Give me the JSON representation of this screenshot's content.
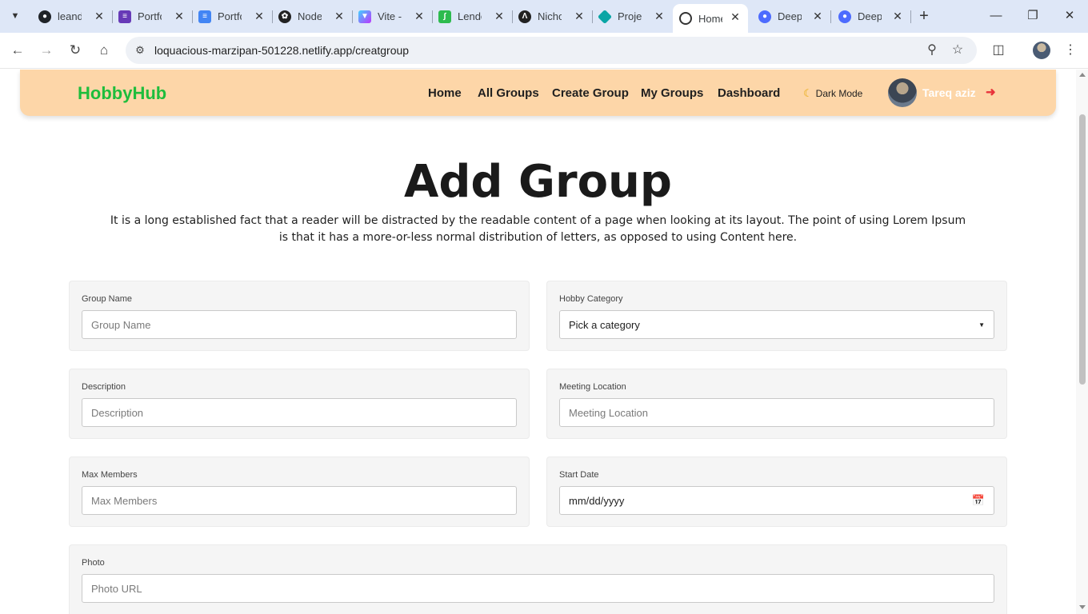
{
  "browser": {
    "tabs": [
      {
        "title": "leand",
        "favicon": "github-icon",
        "color": "#1f2328"
      },
      {
        "title": "Portfo",
        "favicon": "list-doc-icon",
        "color": "#673ab7"
      },
      {
        "title": "Portfo",
        "favicon": "docs-icon",
        "color": "#4285f4"
      },
      {
        "title": "Node",
        "favicon": "openai-icon",
        "color": "#222222"
      },
      {
        "title": "Vite -",
        "favicon": "vite-icon",
        "color": "#a855f7"
      },
      {
        "title": "Lende",
        "favicon": "lendsqr-icon",
        "color": "#2dbb4e"
      },
      {
        "title": "Nicho",
        "favicon": "nicho-icon",
        "color": "#222222"
      },
      {
        "title": "Proje",
        "favicon": "diamond-icon",
        "color": "#0aa5a5"
      },
      {
        "title": "Home",
        "favicon": "home-site-icon",
        "color": "#333333",
        "active": true
      },
      {
        "title": "Deep",
        "favicon": "deepseek-icon",
        "color": "#4d6bfe"
      },
      {
        "title": "Deep",
        "favicon": "deepseek-icon",
        "color": "#4d6bfe"
      }
    ],
    "url": "loquacious-marzipan-501228.netlify.app/creatgroup"
  },
  "navbar": {
    "brand": "HobbyHub",
    "links": [
      "Home",
      "All Groups",
      "Create Group",
      "My Groups",
      "Dashboard"
    ],
    "dark_mode_label": "Dark Mode",
    "user_name": "Tareq aziz",
    "colors": {
      "background": "#fdd6a8",
      "brand": "#1ebd3c",
      "logout": "#e8333b"
    }
  },
  "page": {
    "title": "Add Group",
    "description": "It is a long established fact that a reader will be distracted by the readable content of a page when looking at its layout. The point of using Lorem Ipsum is that it has a more-or-less normal distribution of letters, as opposed to using Content here."
  },
  "form": {
    "group_name": {
      "label": "Group Name",
      "placeholder": "Group Name",
      "value": ""
    },
    "hobby_category": {
      "label": "Hobby Category",
      "selected": "Pick a category"
    },
    "description": {
      "label": "Description",
      "placeholder": "Description",
      "value": ""
    },
    "meeting_location": {
      "label": "Meeting Location",
      "placeholder": "Meeting Location",
      "value": ""
    },
    "max_members": {
      "label": "Max Members",
      "placeholder": "Max Members",
      "value": ""
    },
    "start_date": {
      "label": "Start Date",
      "value": "mm/dd/yyyy"
    },
    "photo": {
      "label": "Photo",
      "placeholder": "Photo URL",
      "value": ""
    }
  }
}
